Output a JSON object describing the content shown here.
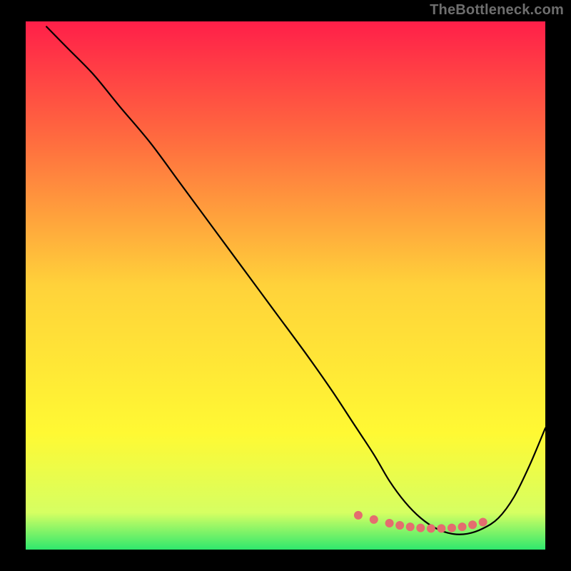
{
  "watermark": "TheBottleneck.com",
  "colors": {
    "bg": "#000000",
    "grad_top": "#ff1f49",
    "grad_mid1": "#ff6a3f",
    "grad_mid2": "#ffd23a",
    "grad_mid3": "#fff933",
    "grad_bot1": "#d6ff62",
    "grad_bot2": "#2fe86d",
    "curve": "#000000",
    "marker_fill": "#e46d6f",
    "marker_stroke": "#e46d6f"
  },
  "chart_data": {
    "type": "line",
    "title": "",
    "xlabel": "",
    "ylabel": "",
    "xlim": [
      0,
      100
    ],
    "ylim": [
      0,
      100
    ],
    "series": [
      {
        "name": "bottleneck-curve",
        "x": [
          4,
          8,
          13,
          18,
          24,
          30,
          36,
          42,
          48,
          54,
          59,
          63,
          67,
          70,
          73,
          76,
          79,
          82,
          85,
          88,
          91,
          94,
          97,
          100
        ],
        "y": [
          99,
          95,
          90,
          84,
          77,
          69,
          61,
          53,
          45,
          37,
          30,
          24,
          18,
          13,
          9,
          6,
          4,
          3,
          3,
          4,
          6,
          10,
          16,
          23
        ]
      }
    ],
    "markers": {
      "name": "highlight-band",
      "x": [
        64,
        67,
        70,
        72,
        74,
        76,
        78,
        80,
        82,
        84,
        86,
        88
      ],
      "y": [
        6.5,
        5.7,
        5.0,
        4.6,
        4.3,
        4.1,
        4.0,
        4.0,
        4.1,
        4.3,
        4.7,
        5.2
      ]
    }
  }
}
